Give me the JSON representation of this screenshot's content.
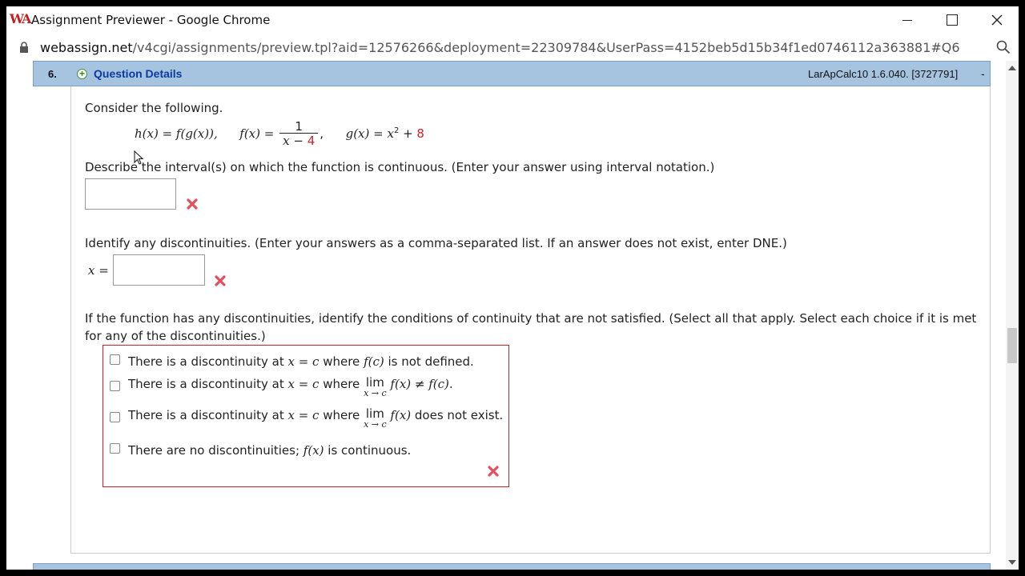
{
  "window": {
    "title": "Assignment Previewer - Google Chrome",
    "logo_text": "WA"
  },
  "address": {
    "domain": "webassign.net",
    "path": "/v4cgi/assignments/preview.tpl?aid=12576266&deployment=22309784&UserPass=4152beb5d15b34f1ed0746112a363881#Q6"
  },
  "question": {
    "number": "6.",
    "details_label": "Question Details",
    "reference": "LarApCalc10 1.6.040. [3727791]",
    "collapse_label": "-",
    "intro": "Consider the following.",
    "formula": {
      "h": "h(x) = f(g(x)),",
      "f_lhs": "f(x) =",
      "f_num": "1",
      "f_den_var": "x − ",
      "f_den_const": "4",
      "f_trail": ",",
      "g_lhs": "g(x) = x",
      "g_exp": "2",
      "g_plus": " + ",
      "g_const": "8"
    },
    "part1": {
      "prompt": "Describe the interval(s) on which the function is continuous. (Enter your answer using interval notation.)",
      "value": ""
    },
    "part2": {
      "prompt": "Identify any discontinuities. (Enter your answers as a comma-separated list. If an answer does not exist, enter DNE.)",
      "label": "x =",
      "value": ""
    },
    "part3": {
      "prompt_line1": "If the function has any discontinuities, identify the conditions of continuity that are not satisfied. (Select all that apply. Select each choice if it is met",
      "prompt_line2": "for any of the discontinuities.)",
      "choices": [
        {
          "pre": "There is a discontinuity at ",
          "mid": "x = c",
          "post": " where ",
          "fc": "f(c)",
          "tail": " is not defined.",
          "checked": false
        },
        {
          "pre": "There is a discontinuity at ",
          "mid": "x = c",
          "post": " where ",
          "lim": "lim",
          "lim_sub": "x → c",
          "fx": "f(x)",
          "neq": " ≠ ",
          "fc": "f(c)",
          "tail": ".",
          "checked": false
        },
        {
          "pre": "There is a discontinuity at ",
          "mid": "x = c",
          "post": " where ",
          "lim": "lim",
          "lim_sub": "x → c",
          "fx": "f(x)",
          "tail": " does not exist.",
          "checked": false
        },
        {
          "pre": "There are no discontinuities; ",
          "fx": "f(x)",
          "tail": " is continuous.",
          "checked": false
        }
      ]
    }
  },
  "colors": {
    "header_bg": "#a6c4e0",
    "link": "#0b3aa0",
    "error_red": "#c0262c"
  },
  "icons": [
    "lock-icon",
    "zoom-icon",
    "plus-icon",
    "x-icon",
    "minimize-icon",
    "maximize-icon",
    "close-icon"
  ]
}
